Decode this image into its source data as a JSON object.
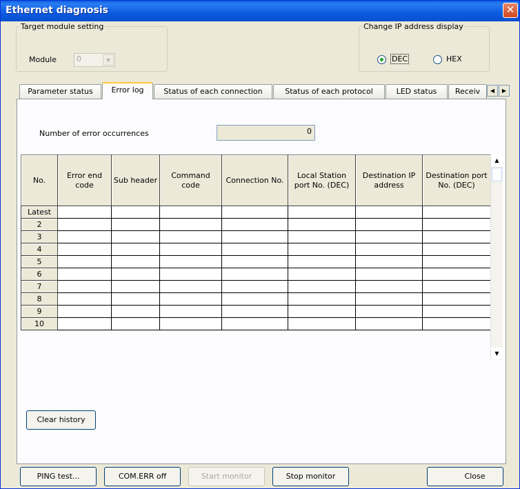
{
  "window": {
    "title": "Ethernet diagnosis",
    "close_glyph": "✕"
  },
  "target_module": {
    "legend": "Target module setting",
    "module_label": "Module",
    "module_value": "0"
  },
  "ip_display": {
    "legend": "Change IP address display",
    "options": [
      "DEC",
      "HEX"
    ],
    "selected": "DEC"
  },
  "tabs": [
    "Parameter status",
    "Error log",
    "Status of each connection",
    "Status of each protocol",
    "LED status",
    "Receiv"
  ],
  "active_tab": "Error log",
  "error_log": {
    "count_label": "Number of error occurrences",
    "count_value": "0",
    "columns": [
      "No.",
      "Error end code",
      "Sub header",
      "Command code",
      "Connection No.",
      "Local Station port No. (DEC)",
      "Destination IP address",
      "Destination port No. (DEC)"
    ],
    "rows": [
      "Latest",
      "2",
      "3",
      "4",
      "5",
      "6",
      "7",
      "8",
      "9",
      "10"
    ],
    "clear_label": "Clear history"
  },
  "buttons": {
    "ping": "PING test...",
    "comerr": "COM.ERR off",
    "start": "Start monitor",
    "stop": "Stop monitor",
    "close": "Close"
  }
}
